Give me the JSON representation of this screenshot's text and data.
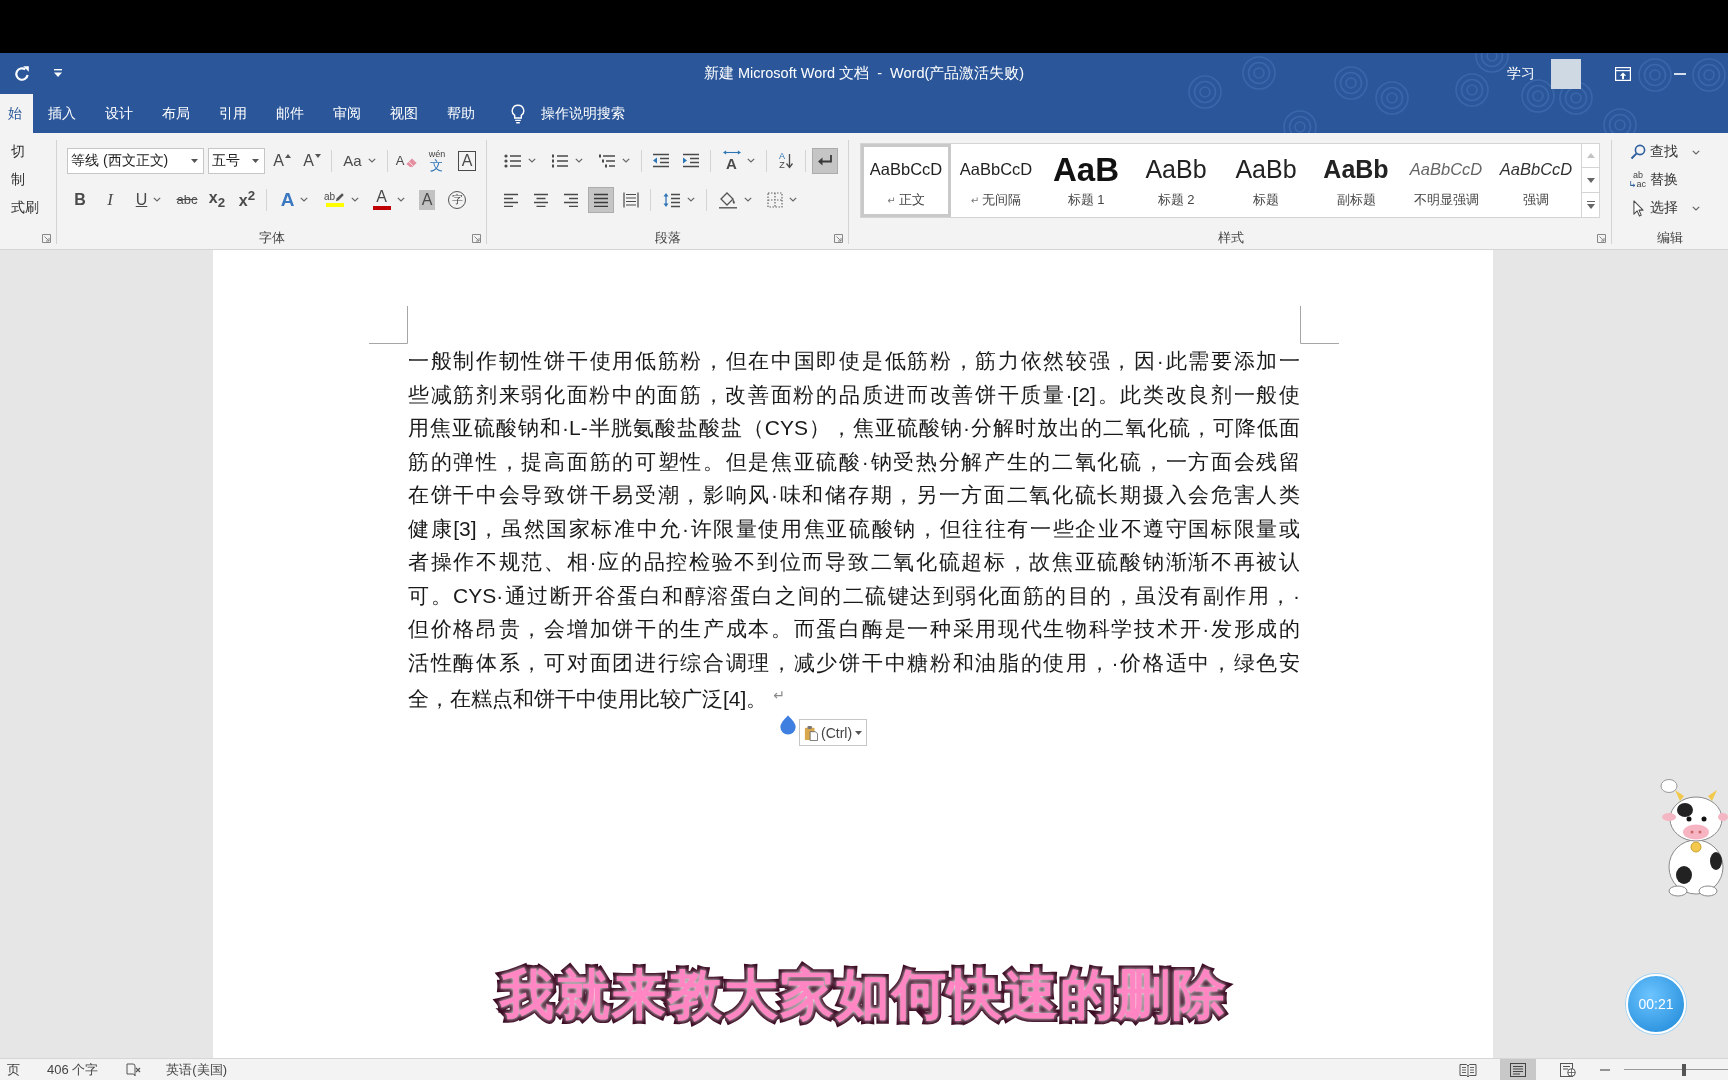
{
  "title_bar": {
    "title": "新建 Microsoft Word 文档  -  Word(产品激活失败)",
    "account": "学习"
  },
  "tabs": [
    {
      "label": "始",
      "selected": true
    },
    {
      "label": "插入",
      "selected": false
    },
    {
      "label": "设计",
      "selected": false
    },
    {
      "label": "布局",
      "selected": false
    },
    {
      "label": "引用",
      "selected": false
    },
    {
      "label": "邮件",
      "selected": false
    },
    {
      "label": "审阅",
      "selected": false
    },
    {
      "label": "视图",
      "selected": false
    },
    {
      "label": "帮助",
      "selected": false
    }
  ],
  "tell_me": {
    "label": "操作说明搜索"
  },
  "clipboard_group": {
    "items": [
      "切",
      "制",
      "式刷"
    ]
  },
  "font_group": {
    "label": "字体",
    "font_name": "等线 (西文正文)",
    "font_size": "五号",
    "row1": [
      {
        "kind": "grow",
        "glyph": "A"
      },
      {
        "kind": "shrink",
        "glyph": "A"
      },
      {
        "kind": "case",
        "glyph": "Aa"
      },
      {
        "kind": "clear",
        "glyph": "A"
      },
      {
        "kind": "phonetic",
        "glyph": "wén",
        "glyph2": "文"
      },
      {
        "kind": "border",
        "glyph": "A"
      }
    ],
    "row2": [
      {
        "kind": "bold",
        "glyph": "B"
      },
      {
        "kind": "italic",
        "glyph": "I"
      },
      {
        "kind": "underline",
        "glyph": "U"
      },
      {
        "kind": "strike",
        "glyph": "abc"
      },
      {
        "kind": "subscript",
        "glyph": "x$_{2}$"
      },
      {
        "kind": "superscript",
        "glyph": "x$^{2}$"
      },
      {
        "kind": "effects",
        "glyph": "A"
      },
      {
        "kind": "highlight",
        "glyph": "ab",
        "color": "#ffff00"
      },
      {
        "kind": "color",
        "glyph": "A",
        "color": "#c00000"
      },
      {
        "kind": "shading",
        "glyph": "A"
      },
      {
        "kind": "enclose",
        "glyph": "字"
      }
    ]
  },
  "paragraph_group": {
    "label": "段落",
    "row1": [
      {
        "kind": "bullets",
        "on": false
      },
      {
        "kind": "numbering",
        "on": false
      },
      {
        "kind": "multilevel",
        "on": false
      },
      {
        "kind": "outdent",
        "on": false
      },
      {
        "kind": "indent",
        "on": false
      },
      {
        "kind": "direction",
        "on": false,
        "glyph": "A"
      },
      {
        "kind": "sort",
        "on": false,
        "glyph": "A",
        "glyph2": "Z"
      },
      {
        "kind": "marks",
        "on": true
      }
    ],
    "row2": [
      {
        "kind": "align-left",
        "on": false
      },
      {
        "kind": "align-center",
        "on": false
      },
      {
        "kind": "align-right",
        "on": false
      },
      {
        "kind": "justify",
        "on": true
      },
      {
        "kind": "distribute",
        "on": false
      },
      {
        "kind": "line-spacing",
        "on": false
      },
      {
        "kind": "shading",
        "on": false
      },
      {
        "kind": "borders",
        "on": false
      }
    ]
  },
  "styles_group": {
    "label": "样式",
    "items": [
      {
        "kind": "normal",
        "preview": "AaBbCcD",
        "mark": "↵",
        "name": "正文",
        "selected": true
      },
      {
        "kind": "normal",
        "preview": "AaBbCcD",
        "mark": "↵",
        "name": "无间隔",
        "selected": false
      },
      {
        "kind": "heading1",
        "preview": "AaB",
        "name": "标题 1",
        "selected": false
      },
      {
        "kind": "heading2",
        "preview": "AaBb",
        "name": "标题 2",
        "selected": false
      },
      {
        "kind": "title",
        "preview": "AaBb",
        "name": "标题",
        "selected": false
      },
      {
        "kind": "subtitle",
        "preview": "AaBb",
        "name": "副标题",
        "selected": false
      },
      {
        "kind": "subtle",
        "preview": "AaBbCcD",
        "name": "不明显强调",
        "selected": false
      },
      {
        "kind": "emphasis",
        "preview": "AaBbCcD",
        "name": "强调",
        "selected": false
      }
    ]
  },
  "editing_group": {
    "label": "编辑",
    "items": [
      {
        "kind": "find",
        "label": "查找"
      },
      {
        "kind": "replace",
        "label": "替换",
        "glyph": "ab",
        "glyph2": "ac"
      },
      {
        "kind": "select",
        "label": "选择"
      }
    ]
  },
  "document": {
    "lines": [
      "一般制作韧性饼干使用低筋粉，但在中国即使是低筋粉，筋力依然较强，因·此需要添加一",
      "些减筋剂来弱化面粉中的面筋，改善面粉的品质进而改善饼干质量·[2]。此类改良剂一般使",
      "用焦亚硫酸钠和·L-半胱氨酸盐酸盐（CYS），焦亚硫酸钠·分解时放出的二氧化硫，可降低面",
      "筋的弹性，提高面筋的可塑性。但是焦亚硫酸·钠受热分解产生的二氧化硫，一方面会残留",
      "在饼干中会导致饼干易受潮，影响风·味和储存期，另一方面二氧化硫长期摄入会危害人类",
      "健康[3]，虽然国家标准中允·许限量使用焦亚硫酸钠，但往往有一些企业不遵守国标限量或",
      "者操作不规范、相·应的品控检验不到位而导致二氧化硫超标，故焦亚硫酸钠渐渐不再被认",
      "可。CYS·通过断开谷蛋白和醇溶蛋白之间的二硫键达到弱化面筋的目的，虽没有副作用，·",
      "但价格昂贵，会增加饼干的生产成本。而蛋白酶是一种采用现代生物科学技术开·发形成的",
      "活性酶体系，可对面团进行综合调理，减少饼干中糖粉和油脂的使用，·价格适中，绿色安",
      "全，在糕点和饼干中使用比较广泛[4]。"
    ],
    "paragraph_mark": "↵",
    "paste_options": {
      "label": "(Ctrl)"
    }
  },
  "status_bar": {
    "page": "页",
    "word_count": "406 个字",
    "language": "英语(美国)",
    "views": [
      {
        "selected": false
      },
      {
        "selected": true
      },
      {
        "selected": false
      }
    ],
    "zoom": {
      "level": 0.58
    }
  },
  "video_overlay": {
    "subtitle": "我就来教大家如何快速的删除",
    "timer": "00:21"
  }
}
